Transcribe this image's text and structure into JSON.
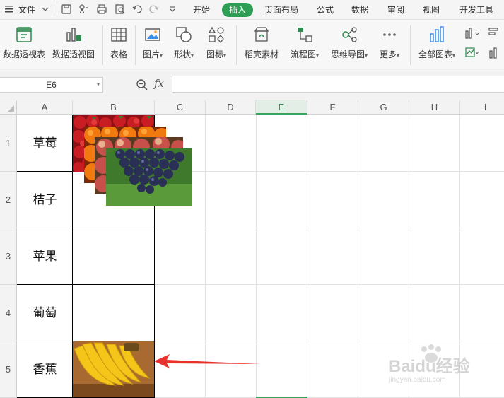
{
  "menubar": {
    "file_label": "文件",
    "tabs": [
      "开始",
      "插入",
      "页面布局",
      "公式",
      "数据",
      "审阅",
      "视图",
      "开发工具"
    ],
    "active_tab": "插入",
    "accent": "#2e9e54"
  },
  "ribbon": {
    "buttons": [
      {
        "label": "数据透视表",
        "icon": "pivot-table-icon"
      },
      {
        "label": "数据透视图",
        "icon": "pivot-chart-icon"
      },
      {
        "label": "表格",
        "icon": "table-icon"
      },
      {
        "label": "图片",
        "icon": "picture-icon",
        "dropdown": true
      },
      {
        "label": "形状",
        "icon": "shape-icon",
        "dropdown": true
      },
      {
        "label": "图标",
        "icon": "icons-icon",
        "dropdown": true
      },
      {
        "label": "稻壳素材",
        "icon": "docer-material-icon"
      },
      {
        "label": "流程图",
        "icon": "flowchart-icon",
        "dropdown": true
      },
      {
        "label": "思维导图",
        "icon": "mindmap-icon",
        "dropdown": true
      },
      {
        "label": "更多",
        "icon": "more-icon",
        "dropdown": true
      },
      {
        "label": "全部图表",
        "icon": "all-charts-icon",
        "dropdown": true
      }
    ]
  },
  "formula_bar": {
    "name_box": "E6",
    "fx_label": "fx",
    "value": ""
  },
  "sheet": {
    "columns": [
      "A",
      "B",
      "C",
      "D",
      "E",
      "F",
      "G",
      "H",
      "I"
    ],
    "selected_column": "E",
    "rows": [
      "1",
      "2",
      "3",
      "4",
      "5"
    ],
    "cells_A": [
      "草莓",
      "桔子",
      "苹果",
      "葡萄",
      "香蕉"
    ]
  },
  "annotation": {
    "arrow_color": "#e8312f",
    "watermark": "Baidu经验",
    "watermark_url": "jingyan.baidu.com"
  }
}
